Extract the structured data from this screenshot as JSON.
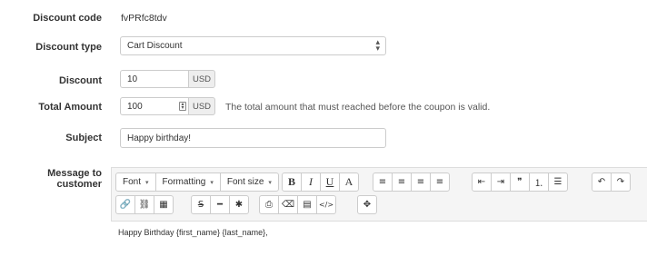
{
  "form": {
    "discount_code": {
      "label": "Discount code",
      "value": "fvPRfc8tdv"
    },
    "discount_type": {
      "label": "Discount type",
      "value": "Cart Discount"
    },
    "discount": {
      "label": "Discount",
      "value": "10",
      "currency": "USD"
    },
    "total_amount": {
      "label": "Total Amount",
      "value": "100",
      "currency": "USD",
      "help": "The total amount that must reached before the coupon is valid."
    },
    "subject": {
      "label": "Subject",
      "value": "Happy birthday!"
    },
    "message": {
      "label": "Message to customer"
    }
  },
  "editor": {
    "toolbar": {
      "font": "Font",
      "formatting": "Formatting",
      "font_size": "Font size",
      "bold": "B",
      "italic": "I",
      "underline": "U",
      "font_color": "A",
      "icons": {
        "align_left": "≡",
        "align_center": "≡",
        "align_right": "≡",
        "justify": "≡",
        "outdent": "⇤",
        "indent": "⇥",
        "blockquote": "❞",
        "ordered_list": "⒈",
        "unordered_list": "☰",
        "undo": "↶",
        "redo": "↷",
        "link": "🔗",
        "unlink": "⛓",
        "table": "▦",
        "strikethrough": "S",
        "hr": "━",
        "special_char": "✱",
        "print": "⎙",
        "eraser": "⌫",
        "paste": "▤",
        "code": "</>",
        "fullscreen": "✥"
      }
    },
    "content": "Happy Birthday {first_name} {last_name},"
  }
}
